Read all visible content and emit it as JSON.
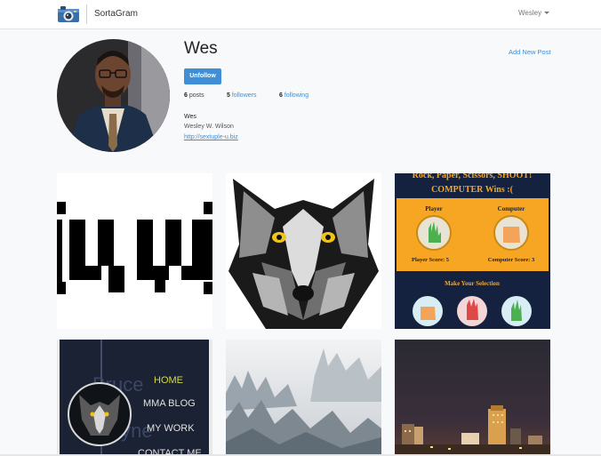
{
  "navbar": {
    "brand": "SortaGram",
    "logo_icon": "camera-icon",
    "user_name": "Wesley"
  },
  "profile": {
    "username": "Wes",
    "add_post_label": "Add New Post",
    "follow_button_label": "Unfollow",
    "stats": {
      "posts_count": "6",
      "posts_label": "posts",
      "followers_count": "5",
      "followers_label": "followers",
      "following_count": "6",
      "following_label": "following"
    },
    "bio": {
      "display_name": "Wes",
      "full_name": "Wesley W. Wilson",
      "website": "http://sextuple-u.biz"
    }
  },
  "posts": {
    "rps": {
      "header": "Rock, Paper, Scissors, SHOOT!",
      "result": "COMPUTER Wins :(",
      "player_label": "Player",
      "computer_label": "Computer",
      "player_score": "Player Score: 5",
      "computer_score": "Computer Score: 3",
      "prompt": "Make Your Selection"
    },
    "site": {
      "bg_text_1": "Bruce",
      "bg_text_2": "Wayne",
      "menu": [
        "HOME",
        "MMA BLOG",
        "MY WORK",
        "CONTACT ME"
      ]
    }
  },
  "colors": {
    "accent": "#3f8ed6",
    "rps_orange": "#f6a623",
    "rps_navy": "#14213f"
  }
}
